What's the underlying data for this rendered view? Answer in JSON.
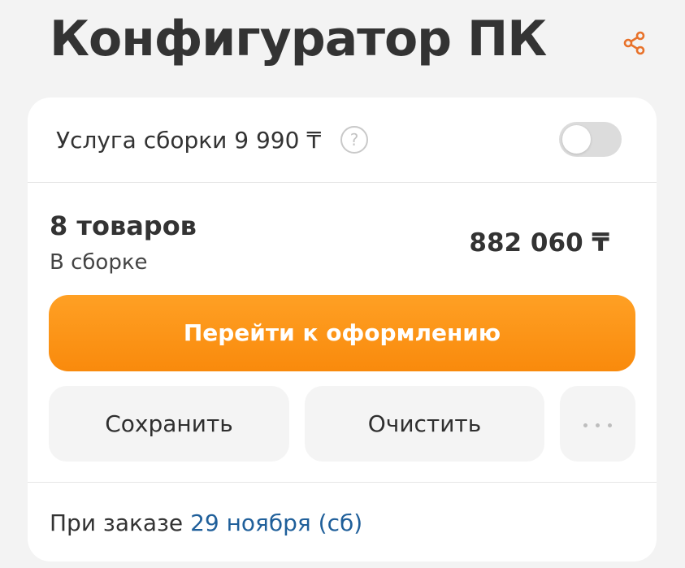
{
  "header": {
    "title": "Конфигуратор ПК",
    "share_icon": "share-icon"
  },
  "service": {
    "label": "Услуга сборки 9 990 ₸",
    "help_glyph": "?",
    "toggle_on": false
  },
  "summary": {
    "items_count": "8 товаров",
    "items_subtitle": "В сборке",
    "total": "882 060 ₸"
  },
  "actions": {
    "checkout_label": "Перейти к оформлению",
    "save_label": "Сохранить",
    "clear_label": "Очистить",
    "more_icon": "more-dots-icon"
  },
  "delivery": {
    "prefix": "При заказе",
    "date": "29 ноября (сб)"
  },
  "colors": {
    "accent": "#f98a0c",
    "link": "#1f5f9a",
    "share_icon": "#e8722a"
  }
}
